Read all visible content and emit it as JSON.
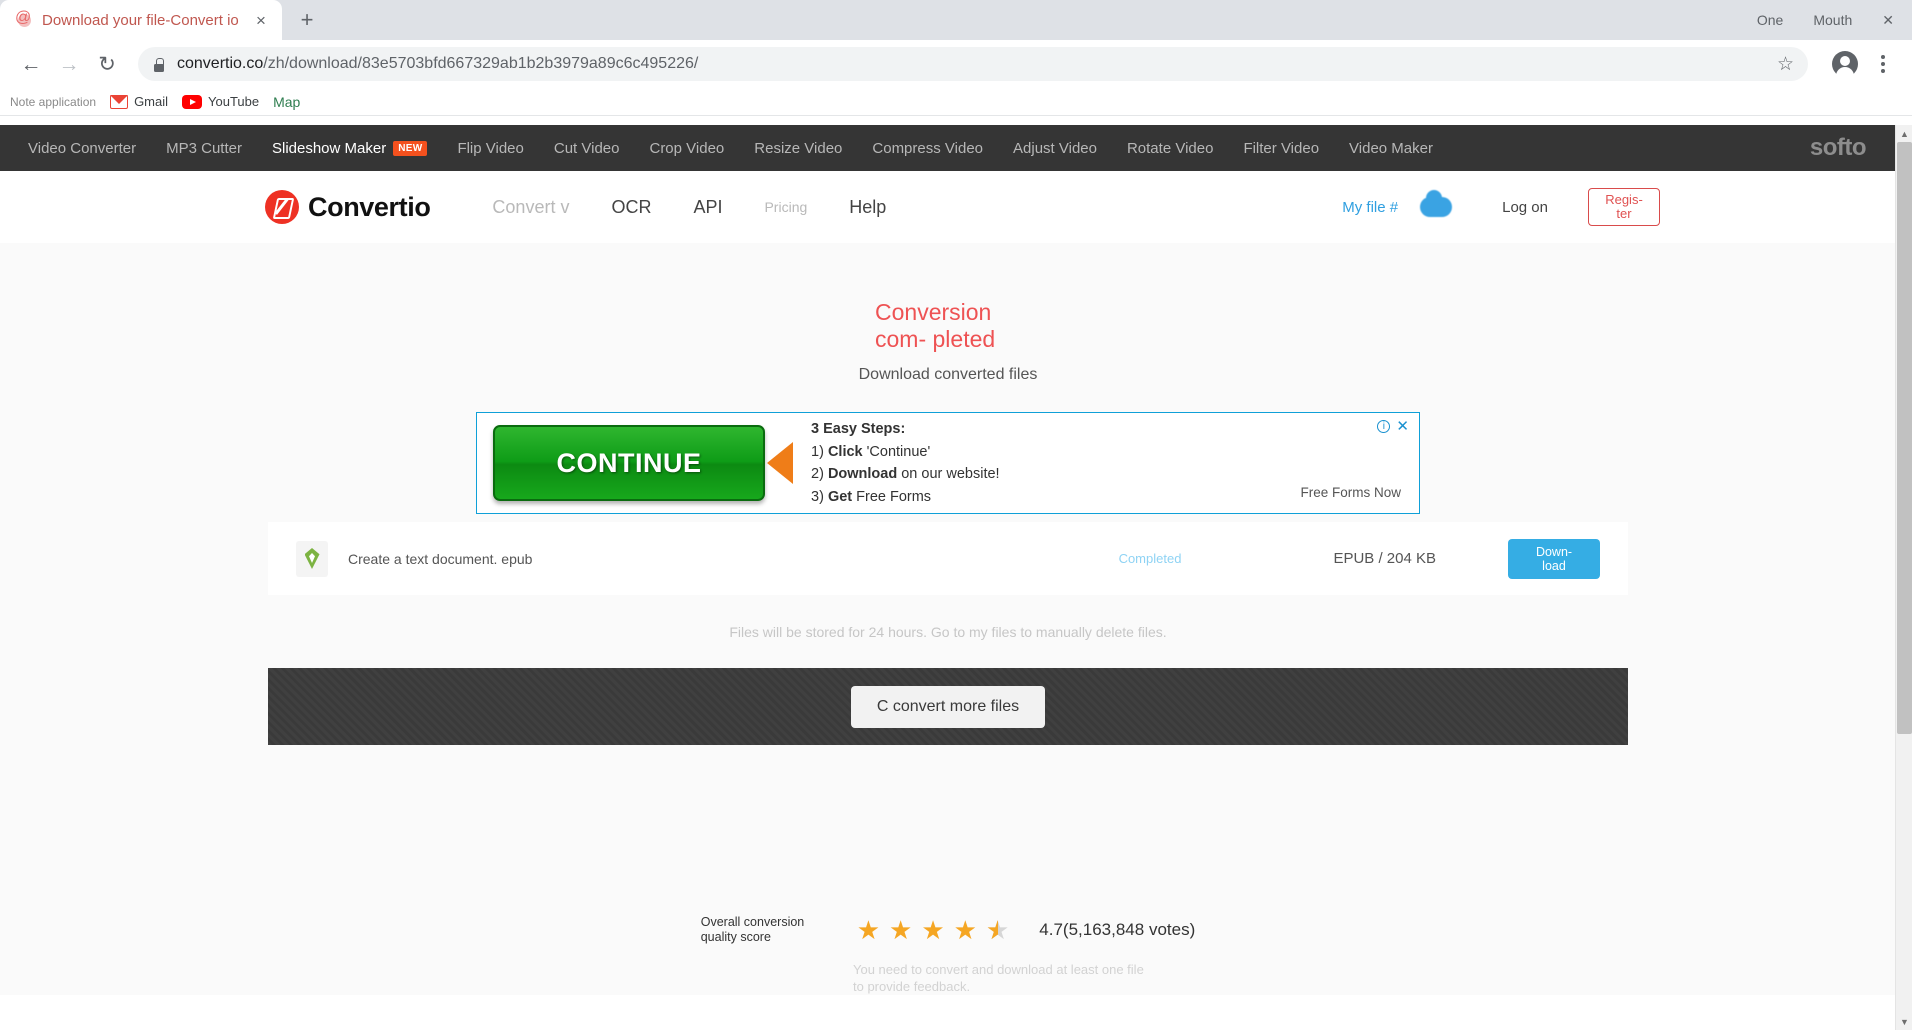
{
  "browser": {
    "tab": {
      "title": "Download your file-Convert io",
      "favicon": "at-sign-icon",
      "close": "×"
    },
    "new_tab": "+",
    "window": {
      "one": "One",
      "mouth": "Mouth",
      "close": "✕"
    },
    "nav": {
      "back": "←",
      "forward": "→",
      "reload": "↻"
    },
    "omnibox": {
      "url_domain": "convertio.co",
      "url_path": "/zh/download/83e5703bfd667329ab1b2b3979a89c6c495226/",
      "star": "☆"
    },
    "bookmarks": [
      {
        "label": "Note application",
        "icon": "note-icon"
      },
      {
        "label": "Gmail",
        "icon": "gmail-icon"
      },
      {
        "label": "YouTube",
        "icon": "youtube-icon"
      },
      {
        "label": "Map",
        "icon": "map-icon"
      }
    ]
  },
  "topbar": {
    "items": [
      {
        "label": "Video Converter",
        "badge": ""
      },
      {
        "label": "MP3 Cutter",
        "badge": ""
      },
      {
        "label": "Slideshow Maker",
        "badge": "NEW"
      },
      {
        "label": "Flip Video",
        "badge": ""
      },
      {
        "label": "Cut Video",
        "badge": ""
      },
      {
        "label": "Crop Video",
        "badge": ""
      },
      {
        "label": "Resize Video",
        "badge": ""
      },
      {
        "label": "Compress Video",
        "badge": ""
      },
      {
        "label": "Adjust Video",
        "badge": ""
      },
      {
        "label": "Rotate Video",
        "badge": ""
      },
      {
        "label": "Filter Video",
        "badge": ""
      },
      {
        "label": "Video Maker",
        "badge": ""
      }
    ],
    "brand": "softo"
  },
  "site_header": {
    "logo_text": "Convertio",
    "nav": [
      {
        "label": "Convert v"
      },
      {
        "label": "OCR"
      },
      {
        "label": "API"
      },
      {
        "label": "Pricing"
      },
      {
        "label": "Help"
      }
    ],
    "my_file": "My file #",
    "log_on": "Log on",
    "register": "Regis-\nter",
    "register_line1": "Regis-",
    "register_line2": "ter"
  },
  "main": {
    "heading": "Conversion com-\npleted",
    "heading_line1": "Conversion com-",
    "heading_line2": "pleted",
    "subheading": "Download converted files",
    "heading_color": "#ee5253"
  },
  "ad": {
    "button_label": "CONTINUE",
    "title": "3 Easy Steps:",
    "steps": [
      {
        "num": "1)",
        "bold": "Click",
        "rest": " 'Continue'"
      },
      {
        "num": "2)",
        "bold": "Download",
        "rest": " on our website!"
      },
      {
        "num": "3)",
        "bold": "Get",
        "rest": " Free Forms"
      }
    ],
    "advertiser": "Free Forms Now",
    "info_icon": "i",
    "close_icon": "✕"
  },
  "file_row": {
    "icon": "epub-file-icon",
    "name": "Create a text document. epub",
    "status": "Completed",
    "meta": "EPUB / 204 KB",
    "download_line1": "Down-",
    "download_line2": "load",
    "download_label": "Download"
  },
  "storage_note": "Files will be stored for 24 hours. Go to my files to manually delete files.",
  "convert_more": {
    "label": "C convert more files"
  },
  "rating": {
    "label": "Overall conversion quality score",
    "stars_filled": 4,
    "stars_half": 1,
    "stars_total": 5,
    "score": "4.7",
    "votes": "(5,163,848 votes)",
    "score_text": "4.7(5,163,848 votes)",
    "feedback_note": "You need to convert and download at least one file to provide feedback.",
    "star_color": "#f5a623"
  },
  "scrollbar": {
    "up": "▲",
    "down": "▼"
  }
}
